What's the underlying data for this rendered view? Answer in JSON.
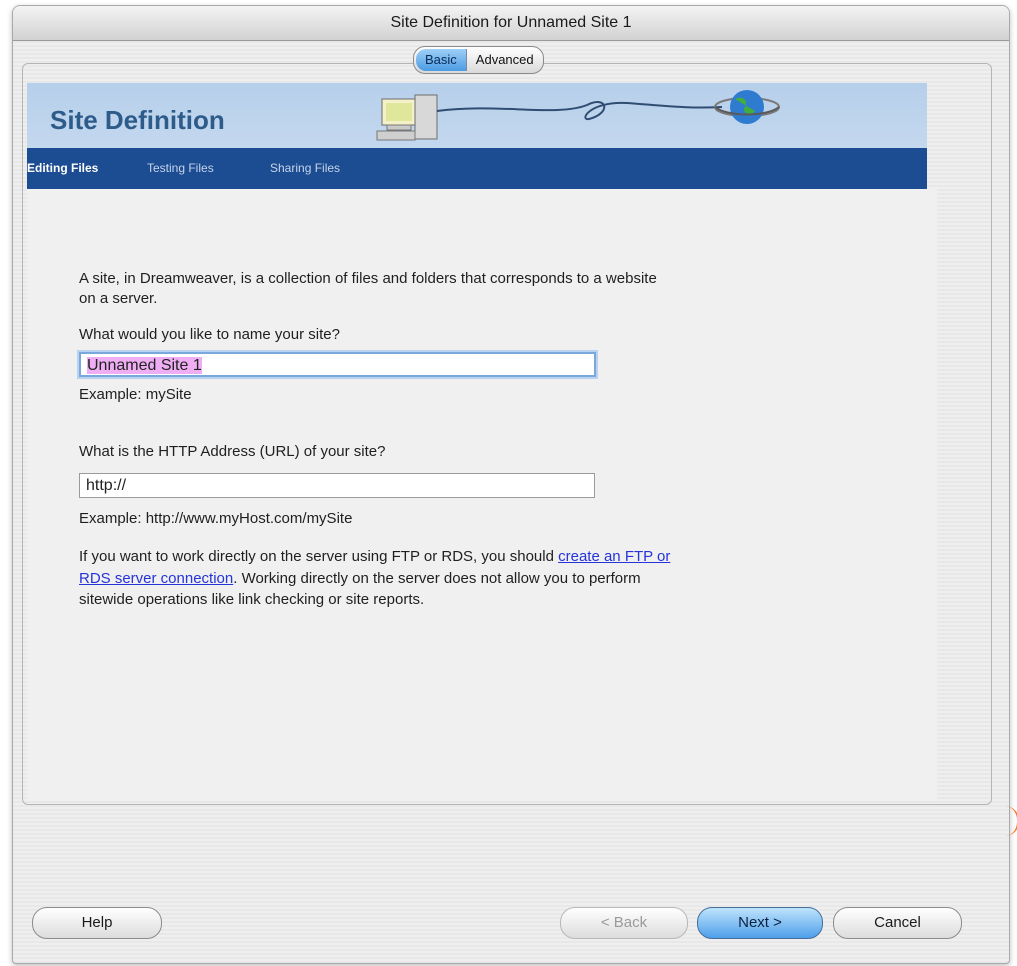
{
  "window": {
    "title": "Site Definition for Unnamed Site 1"
  },
  "mode_tabs": [
    {
      "label": "Basic",
      "selected": true
    },
    {
      "label": "Advanced",
      "selected": false
    }
  ],
  "banner": {
    "title": "Site Definition"
  },
  "steps": [
    {
      "label": "Editing Files",
      "active": true
    },
    {
      "label": "Testing Files",
      "active": false
    },
    {
      "label": "Sharing Files",
      "active": false
    }
  ],
  "content": {
    "intro_line1": "A site, in Dreamweaver, is a collection of files and folders that corresponds to a website",
    "intro_line2": "on a server.",
    "name_question": "What would you like to name your site?",
    "name_value": "Unnamed Site 1",
    "name_example": "Example: mySite",
    "url_question": "What is the HTTP Address (URL) of your site?",
    "url_value": "http://",
    "url_example": "Example: http://www.myHost.com/mySite",
    "ftp_line1_pre": "If you want to work directly on the server using FTP or RDS, you should ",
    "ftp_link1": "create an FTP or",
    "ftp_link2": "RDS server connection",
    "ftp_line2_post": ". Working directly on the server does not allow you to perform",
    "ftp_line3": "sitewide operations like link checking or site reports."
  },
  "buttons": {
    "help": "Help",
    "back": "< Back",
    "next": "Next >",
    "cancel": "Cancel"
  },
  "colors": {
    "nav_bar": "#1c4c91",
    "banner": "#b6cfea",
    "link": "#2533d9",
    "selection": "#efaef3",
    "default_button": "#4e9fe9"
  }
}
